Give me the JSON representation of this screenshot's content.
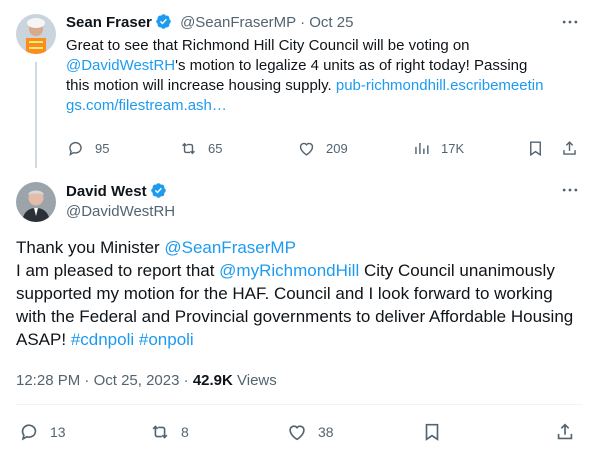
{
  "reply_tweet": {
    "author_name": "Sean Fraser",
    "handle": "@SeanFraserMP",
    "separator": "·",
    "date": "Oct 25",
    "text": {
      "p1": "Great to see that Richmond Hill City Council will be voting on",
      "mention": "@DavidWestRH",
      "p2": "'s motion to legalize 4 units as of right today! Passing this motion will increase housing supply.",
      "link": "pub-richmondhill.escribemeetings.com/filestream.ash…"
    },
    "actions": {
      "replies": "95",
      "reposts": "65",
      "likes": "209",
      "views": "17K"
    }
  },
  "main_tweet": {
    "author_name": "David West",
    "handle": "@DavidWestRH",
    "text": {
      "p1": "Thank you Minister ",
      "mention1": "@SeanFraserMP",
      "p2": "I am pleased to report that ",
      "mention2": "@myRichmondHill",
      "p3": " City Council unanimously supported my motion for the HAF.  Council and I look forward to working with the Federal  and Provincial governments to deliver Affordable Housing ASAP! ",
      "hashtag1": "#cdnpoli",
      "hashtag2": "#onpoli"
    },
    "meta": {
      "time": "12:28 PM",
      "separator": "·",
      "date": "Oct 25, 2023",
      "separator2": "·",
      "views_count": "42.9K",
      "views_label": "Views"
    },
    "actions": {
      "replies": "13",
      "reposts": "8",
      "likes": "38"
    }
  },
  "colors": {
    "link": "#1d9bf0",
    "verified": "#1d9bf0",
    "muted": "#536471",
    "thread_line": "#cfd9de"
  },
  "icons": [
    "verified-icon",
    "more-icon",
    "reply-icon",
    "repost-icon",
    "like-icon",
    "views-icon",
    "bookmark-icon",
    "share-icon"
  ]
}
